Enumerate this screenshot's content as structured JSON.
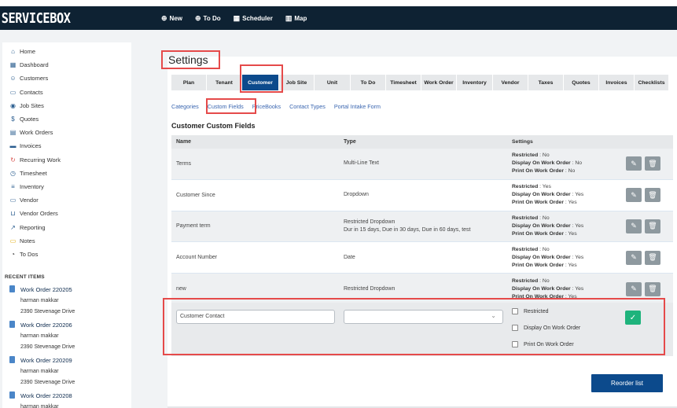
{
  "app": {
    "logo": "SERVICEBOX"
  },
  "topnav": [
    {
      "icon": "plus-circle-icon",
      "glyph": "⊕",
      "label": "New"
    },
    {
      "icon": "plus-circle-icon",
      "glyph": "⊕",
      "label": "To Do"
    },
    {
      "icon": "calendar-icon",
      "glyph": "▦",
      "label": "Scheduler"
    },
    {
      "icon": "map-icon",
      "glyph": "▥",
      "label": "Map"
    }
  ],
  "sidebar": {
    "items": [
      {
        "label": "Home",
        "icon": "home-icon",
        "glyph": "⌂"
      },
      {
        "label": "Dashboard",
        "icon": "dashboard-icon",
        "glyph": "▦"
      },
      {
        "label": "Customers",
        "icon": "users-icon",
        "glyph": "☺"
      },
      {
        "label": "Contacts",
        "icon": "contacts-icon",
        "glyph": "▭"
      },
      {
        "label": "Job Sites",
        "icon": "location-icon",
        "glyph": "◉"
      },
      {
        "label": "Quotes",
        "icon": "dollar-icon",
        "glyph": "$"
      },
      {
        "label": "Work Orders",
        "icon": "document-icon",
        "glyph": "▤"
      },
      {
        "label": "Invoices",
        "icon": "invoice-icon",
        "glyph": "▬"
      },
      {
        "label": "Recurring Work",
        "icon": "recurring-icon",
        "glyph": "↻"
      },
      {
        "label": "Timesheet",
        "icon": "stopwatch-icon",
        "glyph": "◷"
      },
      {
        "label": "Inventory",
        "icon": "list-icon",
        "glyph": "≡"
      },
      {
        "label": "Vendor",
        "icon": "truck-icon",
        "glyph": "▭"
      },
      {
        "label": "Vendor Orders",
        "icon": "cart-icon",
        "glyph": "⊔"
      },
      {
        "label": "Reporting",
        "icon": "chart-line-icon",
        "glyph": "↗"
      },
      {
        "label": "Notes",
        "icon": "note-icon",
        "glyph": "▭"
      },
      {
        "label": "To Dos",
        "icon": "clock-icon",
        "glyph": "◔"
      }
    ]
  },
  "recent": {
    "title": "RECENT ITEMS",
    "items": [
      {
        "title": "Work Order 220205",
        "customer": "harman makkar",
        "address": "2390 Stevenage Drive"
      },
      {
        "title": "Work Order 220206",
        "customer": "harman makkar",
        "address": "2390 Stevenage Drive"
      },
      {
        "title": "Work Order 220209",
        "customer": "harman makkar",
        "address": "2390 Stevenage Drive"
      },
      {
        "title": "Work Order 220208",
        "customer": "harman makkar",
        "address": ""
      }
    ]
  },
  "page": {
    "title": "Settings"
  },
  "tabs": [
    {
      "label": "Plan",
      "active": false
    },
    {
      "label": "Tenant",
      "active": false
    },
    {
      "label": "Customer",
      "active": true
    },
    {
      "label": "Job Site",
      "active": false
    },
    {
      "label": "Unit",
      "active": false
    },
    {
      "label": "To Do",
      "active": false
    },
    {
      "label": "Timesheet",
      "active": false
    },
    {
      "label": "Work Order",
      "active": false
    },
    {
      "label": "Inventory",
      "active": false
    },
    {
      "label": "Vendor",
      "active": false
    },
    {
      "label": "Taxes",
      "active": false
    },
    {
      "label": "Quotes",
      "active": false
    },
    {
      "label": "Invoices",
      "active": false
    },
    {
      "label": "Checklists",
      "active": false
    }
  ],
  "subtabs": [
    {
      "label": "Categories",
      "active": false
    },
    {
      "label": "Custom Fields",
      "active": true
    },
    {
      "label": "PriceBooks",
      "active": false
    },
    {
      "label": "Contact Types",
      "active": false
    },
    {
      "label": "Portal Intake Form",
      "active": false
    }
  ],
  "section": {
    "title": "Customer Custom Fields"
  },
  "table": {
    "headers": {
      "name": "Name",
      "type": "Type",
      "settings": "Settings"
    },
    "settings_labels": {
      "restricted": "Restricted",
      "display": "Display On Work Order",
      "print": "Print On Work Order"
    },
    "rows": [
      {
        "name": "Terms",
        "type": "Multi-Line Text",
        "type_detail": "",
        "restricted": "No",
        "display": "No",
        "print": "No"
      },
      {
        "name": "Customer Since",
        "type": "Dropdown",
        "type_detail": "",
        "restricted": "Yes",
        "display": "Yes",
        "print": "Yes"
      },
      {
        "name": "Payment term",
        "type": "Restricted Dropdown",
        "type_detail": "Dur in 15 days, Due in 30 days, Due in 60 days, test",
        "restricted": "No",
        "display": "Yes",
        "print": "Yes"
      },
      {
        "name": "Account Number",
        "type": "Date",
        "type_detail": "",
        "restricted": "No",
        "display": "Yes",
        "print": "Yes"
      },
      {
        "name": "new",
        "type": "Restricted Dropdown",
        "type_detail": "",
        "restricted": "No",
        "display": "Yes",
        "print": "Yes"
      }
    ]
  },
  "new_field": {
    "name_value": "Customer Contact",
    "type_value": "",
    "checkboxes": [
      {
        "label": "Restricted",
        "checked": false
      },
      {
        "label": "Display On Work Order",
        "checked": false
      },
      {
        "label": "Print On Work Order",
        "checked": false
      }
    ]
  },
  "buttons": {
    "reorder": "Reorder list"
  }
}
